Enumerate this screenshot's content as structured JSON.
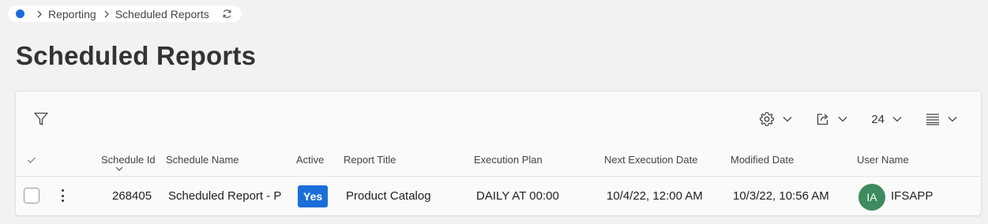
{
  "breadcrumb": {
    "items": [
      "Reporting",
      "Scheduled Reports"
    ]
  },
  "page": {
    "title": "Scheduled Reports"
  },
  "toolbar": {
    "page_size": "24"
  },
  "columns": {
    "schedule_id": "Schedule Id",
    "schedule_name": "Schedule Name",
    "active": "Active",
    "report_title": "Report Title",
    "execution_plan": "Execution Plan",
    "next_execution_date": "Next Execution Date",
    "modified_date": "Modified Date",
    "user_name": "User Name"
  },
  "rows": [
    {
      "schedule_id": "268405",
      "schedule_name": "Scheduled Report - P",
      "active": "Yes",
      "report_title": "Product Catalog",
      "execution_plan": "DAILY AT 00:00",
      "next_execution_date": "10/4/22, 12:00 AM",
      "modified_date": "10/3/22, 10:56 AM",
      "user_initials": "IA",
      "user_name": "IFSAPP"
    }
  ],
  "colors": {
    "accent": "#1a6ed8",
    "avatar": "#3d8b5f"
  }
}
